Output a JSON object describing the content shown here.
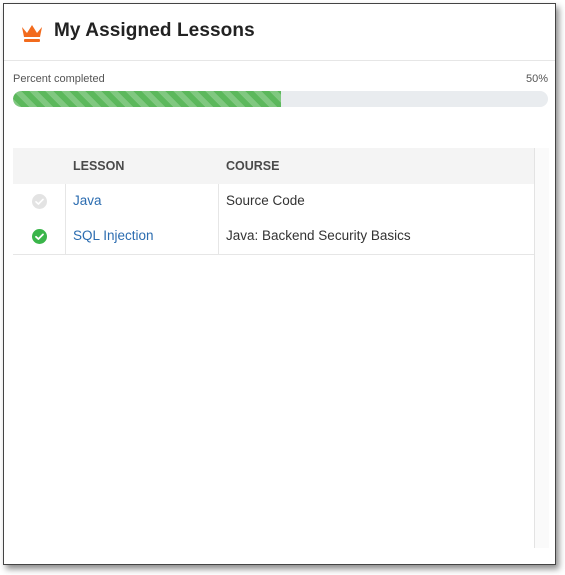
{
  "header": {
    "title": "My Assigned Lessons",
    "icon": "crown-icon",
    "icon_color": "#f26b1d"
  },
  "progress": {
    "label": "Percent completed",
    "value_text": "50%",
    "fraction": 0.5,
    "bar_color": "#5cb85c",
    "track_color": "#e9ecef"
  },
  "table": {
    "columns": [
      "",
      "LESSON",
      "COURSE"
    ],
    "rows": [
      {
        "status": "incomplete",
        "status_icon": "check-circle-gray-icon",
        "lesson": "Java",
        "course": "Source Code"
      },
      {
        "status": "complete",
        "status_icon": "check-circle-green-icon",
        "lesson": "SQL Injection",
        "course": "Java: Backend Security Basics"
      }
    ]
  },
  "colors": {
    "link": "#2b6cb0",
    "complete": "#3ab54a",
    "incomplete": "#e3e3e3",
    "header_bg": "#f4f4f4"
  }
}
